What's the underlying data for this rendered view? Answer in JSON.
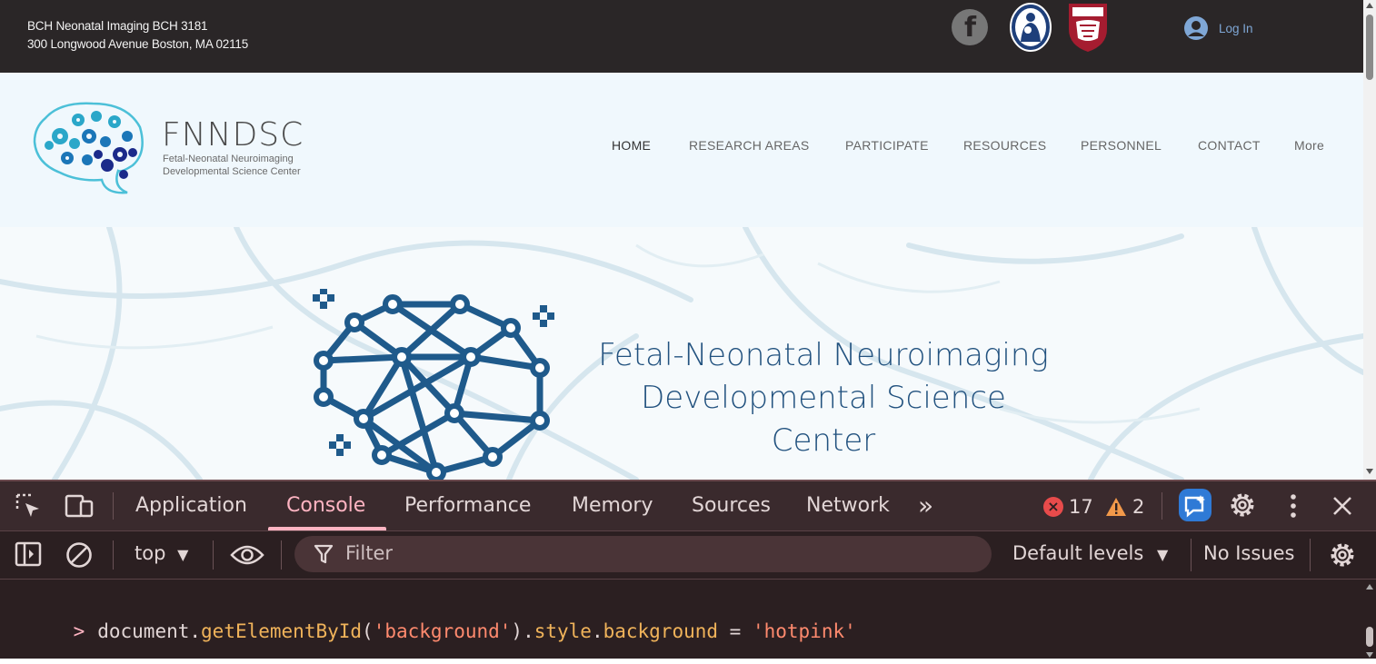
{
  "site": {
    "address_line1": "BCH Neonatal Imaging BCH 3181",
    "address_line2": "300 Longwood Avenue Boston, MA 02115",
    "login_label": "Log In",
    "brand_title": "FNNDSC",
    "brand_sub1": "Fetal-Neonatal Neuroimaging",
    "brand_sub2": "Developmental Science Center",
    "nav": [
      "HOME",
      "RESEARCH AREAS",
      "PARTICIPATE",
      "RESOURCES",
      "PERSONNEL",
      "CONTACT",
      "More"
    ],
    "active_nav": "HOME",
    "hero_line1": "Fetal-Neonatal Neuroimaging",
    "hero_line2": "Developmental Science Center",
    "colors": {
      "topbar": "#2a2627",
      "header": "#f0f8fd",
      "hero_text": "#22527f",
      "logo_blue": "#1f5a8b"
    },
    "icons": [
      "facebook-icon",
      "bch-logo-icon",
      "harvard-shield-icon",
      "user-avatar-icon"
    ]
  },
  "devtools": {
    "tabs": [
      "Application",
      "Console",
      "Performance",
      "Memory",
      "Sources",
      "Network"
    ],
    "active_tab": "Console",
    "more_tabs": "»",
    "errors": "17",
    "warnings": "2",
    "context": "top",
    "filter_placeholder": "Filter",
    "levels": "Default levels",
    "issues": "No Issues",
    "console": {
      "prompt": ">",
      "tokens": [
        {
          "t": "document.",
          "c": "id"
        },
        {
          "t": "getElementById",
          "c": "fn"
        },
        {
          "t": "(",
          "c": "id"
        },
        {
          "t": "'background'",
          "c": "str"
        },
        {
          "t": ").",
          "c": "id"
        },
        {
          "t": "style",
          "c": "prop"
        },
        {
          "t": ".",
          "c": "id"
        },
        {
          "t": "background",
          "c": "prop"
        },
        {
          "t": " = ",
          "c": "id"
        },
        {
          "t": "'hotpink'",
          "c": "str"
        }
      ]
    },
    "icons": [
      "inspect-element-icon",
      "device-toolbar-icon",
      "more-tabs-icon",
      "error-icon",
      "warning-icon",
      "ai-assistant-icon",
      "settings-icon",
      "kebab-menu-icon",
      "close-icon",
      "sidebar-toggle-icon",
      "clear-console-icon",
      "eye-icon",
      "filter-icon",
      "dropdown-icon"
    ],
    "colors": {
      "background": "#2b1f21",
      "accent": "#ffb4c2",
      "error": "#e84b4b",
      "warning": "#f2994a"
    }
  }
}
